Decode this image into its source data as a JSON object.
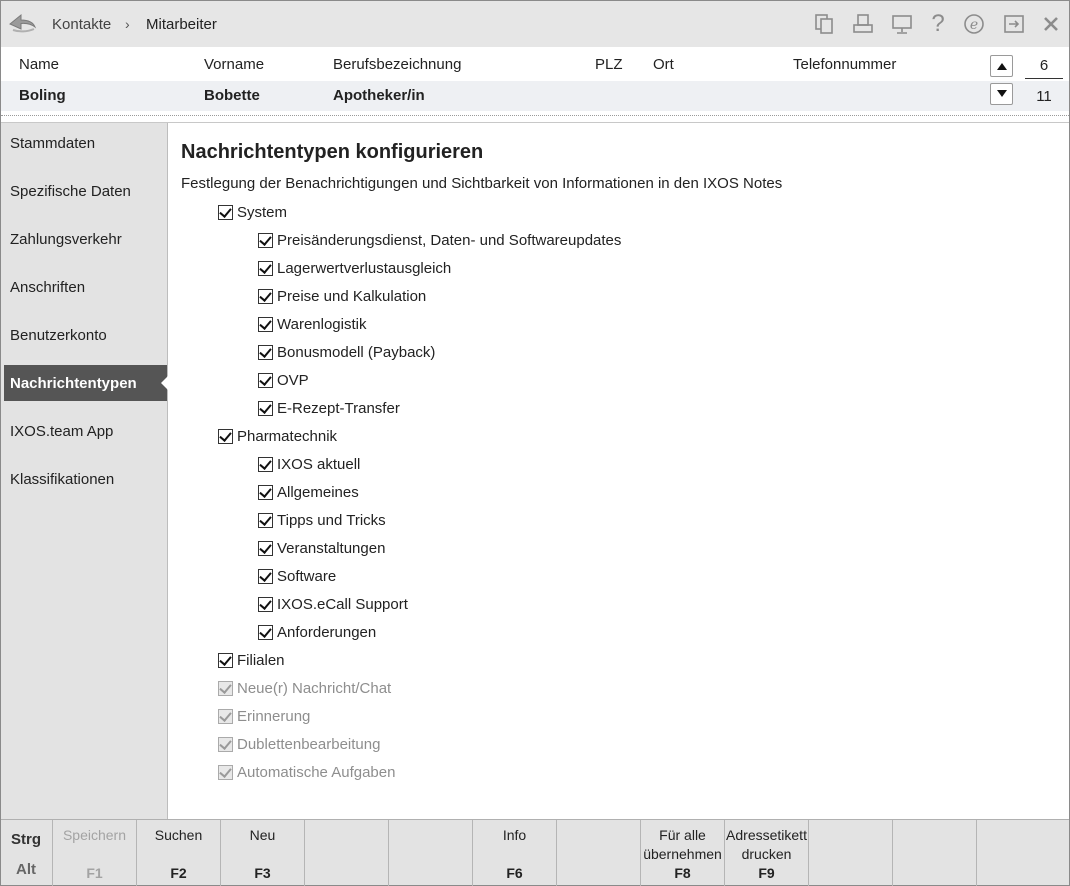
{
  "breadcrumb": {
    "first": "Kontakte",
    "separator": "›",
    "second": "Mitarbeiter"
  },
  "toolbar_icons": [
    "copy-icon",
    "print-icon",
    "monitor-icon",
    "help-icon",
    "ixos-e-icon",
    "export-icon",
    "close-icon"
  ],
  "header": {
    "columns": {
      "name": "Name",
      "vorname": "Vorname",
      "beruf": "Berufsbezeichnung",
      "plz": "PLZ",
      "ort": "Ort",
      "telefon": "Telefonnummer"
    },
    "record": {
      "name": "Boling",
      "vorname": "Bobette",
      "beruf": "Apotheker/in",
      "plz": "",
      "ort": "",
      "telefon": ""
    },
    "counter_current": "6",
    "counter_total": "11"
  },
  "sidebar": {
    "items": [
      {
        "label": "Stammdaten"
      },
      {
        "label": "Spezifische Daten"
      },
      {
        "label": "Zahlungsverkehr"
      },
      {
        "label": "Anschriften"
      },
      {
        "label": "Benutzerkonto"
      },
      {
        "label": "Nachrichtentypen",
        "active": true
      },
      {
        "label": "IXOS.team App"
      },
      {
        "label": "Klassifikationen"
      }
    ]
  },
  "main": {
    "title": "Nachrichtentypen konfigurieren",
    "subtitle": "Festlegung der Benachrichtigungen und Sichtbarkeit von Informationen in den IXOS Notes",
    "checkboxes": [
      {
        "label": "System",
        "checked": true,
        "level": 0,
        "disabled": false
      },
      {
        "label": "Preisänderungsdienst, Daten- und Softwareupdates",
        "checked": true,
        "level": 1,
        "disabled": false
      },
      {
        "label": "Lagerwertverlustausgleich",
        "checked": true,
        "level": 1,
        "disabled": false
      },
      {
        "label": "Preise und Kalkulation",
        "checked": true,
        "level": 1,
        "disabled": false
      },
      {
        "label": "Warenlogistik",
        "checked": true,
        "level": 1,
        "disabled": false
      },
      {
        "label": "Bonusmodell (Payback)",
        "checked": true,
        "level": 1,
        "disabled": false
      },
      {
        "label": "OVP",
        "checked": true,
        "level": 1,
        "disabled": false
      },
      {
        "label": "E-Rezept-Transfer",
        "checked": true,
        "level": 1,
        "disabled": false
      },
      {
        "label": "Pharmatechnik",
        "checked": true,
        "level": 0,
        "disabled": false
      },
      {
        "label": "IXOS aktuell",
        "checked": true,
        "level": 1,
        "disabled": false
      },
      {
        "label": "Allgemeines",
        "checked": true,
        "level": 1,
        "disabled": false
      },
      {
        "label": "Tipps und Tricks",
        "checked": true,
        "level": 1,
        "disabled": false
      },
      {
        "label": "Veranstaltungen",
        "checked": true,
        "level": 1,
        "disabled": false
      },
      {
        "label": "Software",
        "checked": true,
        "level": 1,
        "disabled": false
      },
      {
        "label": "IXOS.eCall Support",
        "checked": true,
        "level": 1,
        "disabled": false
      },
      {
        "label": "Anforderungen",
        "checked": true,
        "level": 1,
        "disabled": false
      },
      {
        "label": "Filialen",
        "checked": true,
        "level": 0,
        "disabled": false
      },
      {
        "label": "Neue(r) Nachricht/Chat",
        "checked": true,
        "level": 0,
        "disabled": true
      },
      {
        "label": "Erinnerung",
        "checked": true,
        "level": 0,
        "disabled": true
      },
      {
        "label": "Dublettenbearbeitung",
        "checked": true,
        "level": 0,
        "disabled": true
      },
      {
        "label": "Automatische Aufgaben",
        "checked": true,
        "level": 0,
        "disabled": true
      }
    ]
  },
  "fkeys": {
    "modifiers": {
      "strg": "Strg",
      "alt": "Alt"
    },
    "keys": [
      {
        "label": "Speichern",
        "key": "F1",
        "disabled": true
      },
      {
        "label": "Suchen",
        "key": "F2",
        "disabled": false
      },
      {
        "label": "Neu",
        "key": "F3",
        "disabled": false
      },
      {
        "label": "",
        "key": "",
        "disabled": false
      },
      {
        "label": "",
        "key": "",
        "disabled": false
      },
      {
        "label": "Info",
        "key": "F6",
        "disabled": false
      },
      {
        "label": "",
        "key": "",
        "disabled": false
      },
      {
        "label": "Für alle übernehmen",
        "key": "F8",
        "disabled": false
      },
      {
        "label": "Adressetikett drucken",
        "key": "F9",
        "disabled": false
      },
      {
        "label": "",
        "key": "",
        "disabled": false
      },
      {
        "label": "",
        "key": "",
        "disabled": false
      },
      {
        "label": "",
        "key": "",
        "disabled": false
      }
    ]
  }
}
